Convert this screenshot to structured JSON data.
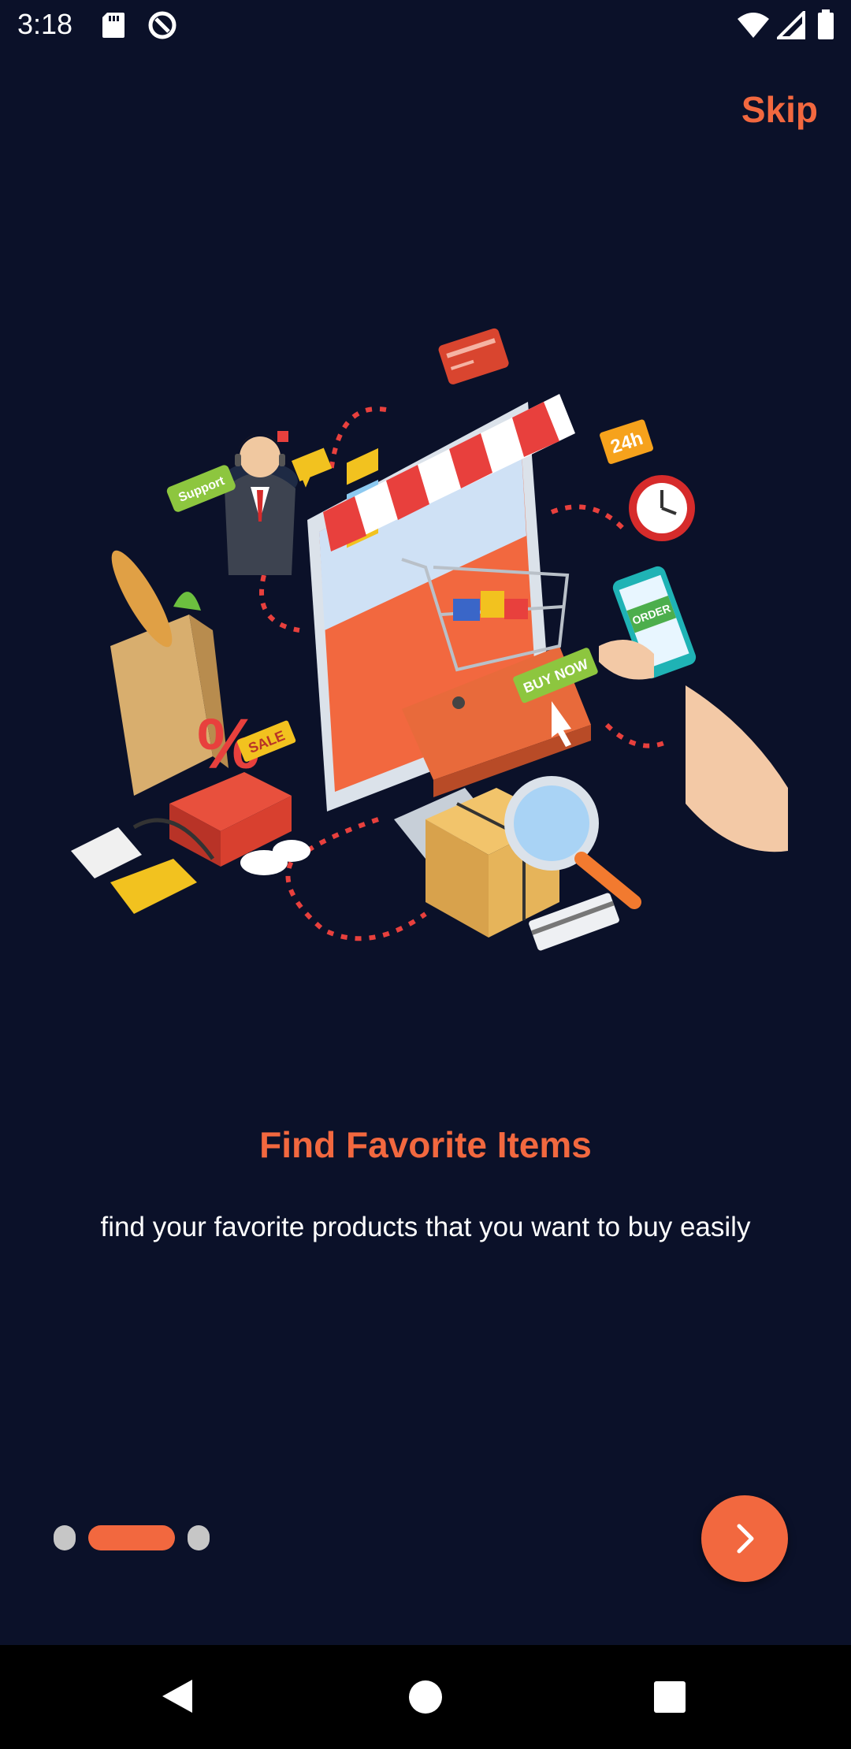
{
  "status_bar": {
    "time": "3:18",
    "icons": [
      "sd-card-icon",
      "sync-icon",
      "wifi-icon",
      "signal-icon",
      "battery-icon"
    ]
  },
  "header": {
    "skip_label": "Skip"
  },
  "illustration": {
    "support_label": "Support",
    "sale_label": "SALE",
    "buy_now_label": "BUY NOW",
    "order_label": "ORDER",
    "hours_label": "24h"
  },
  "onboarding": {
    "title": "Find Favorite Items",
    "description": "find your favorite products that you want to buy easily",
    "current_page": 2,
    "total_pages": 3
  },
  "colors": {
    "background": "#0b1129",
    "accent": "#f2683f",
    "inactive_dot": "#c6c6c6"
  },
  "navigation": {
    "icons": [
      "back-icon",
      "home-icon",
      "recents-icon"
    ]
  }
}
